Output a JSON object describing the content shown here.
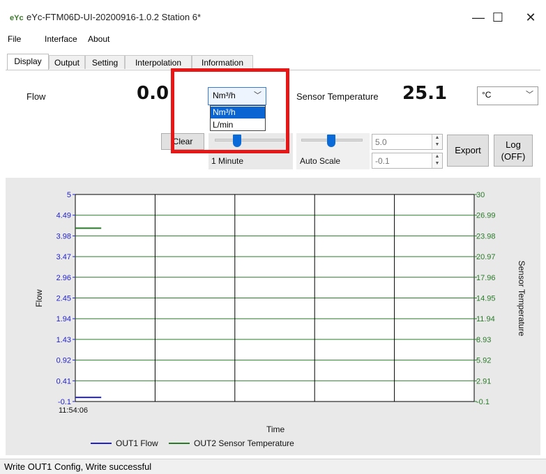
{
  "window": {
    "app_icon_text": "eYc",
    "title": "eYc-FTM06D-UI-20200916-1.0.2  Station 6*",
    "minimize": "—",
    "maximize": "☐",
    "close": "✕"
  },
  "menu": [
    "File",
    "Interface",
    "About"
  ],
  "tabs": [
    "Display",
    "Output",
    "Setting",
    "Interpolation",
    "Information"
  ],
  "display": {
    "flow_label": "Flow",
    "flow_value": "0.0",
    "unit_selected": "Nm³/h",
    "unit_options": [
      "Nm³/h",
      "L/min"
    ],
    "sensor_temp_label": "Sensor Temperature",
    "sensor_temp_value": "25.1",
    "temp_unit": "°C",
    "clear_label": "Clear",
    "time_range_label": "1 Minute",
    "scale_label": "Auto Scale",
    "scale_max": "5.0",
    "scale_min": "-0.1",
    "export_label": "Export",
    "log_label_line1": "Log",
    "log_label_line2": "(OFF)"
  },
  "colors": {
    "highlight": "#e81717",
    "flow_series": "#2222cc",
    "temp_series": "#2a7a2a",
    "selection": "#0a64d2"
  },
  "chart_data": {
    "type": "line",
    "title": "",
    "xlabel": "Time",
    "ylabel": "Flow",
    "y2label": "Sensor Temperature",
    "x_tick_labels": [
      "11:54:06"
    ],
    "y_ticks": [
      "5",
      "4.49",
      "3.98",
      "3.47",
      "2.96",
      "2.45",
      "1.94",
      "1.43",
      "0.92",
      "0.41",
      "-0.1"
    ],
    "y2_ticks": [
      "30",
      "26.99",
      "23.98",
      "20.97",
      "17.96",
      "14.95",
      "11.94",
      "8.93",
      "5.92",
      "2.91",
      "-0.1"
    ],
    "ylim": [
      -0.1,
      5
    ],
    "y2lim": [
      -0.1,
      30
    ],
    "grid": true,
    "legend": "bottom",
    "series": [
      {
        "name": "OUT1 Flow",
        "axis": "left",
        "color": "#2222cc",
        "x": [
          0,
          0.065
        ],
        "y": [
          0.0,
          0.0
        ]
      },
      {
        "name": "OUT2 Sensor Temperature",
        "axis": "right",
        "color": "#2a7a2a",
        "x": [
          0,
          0.065
        ],
        "y": [
          25.1,
          25.1
        ]
      }
    ]
  },
  "status": {
    "text": "Write OUT1 Config,  Write successful"
  }
}
